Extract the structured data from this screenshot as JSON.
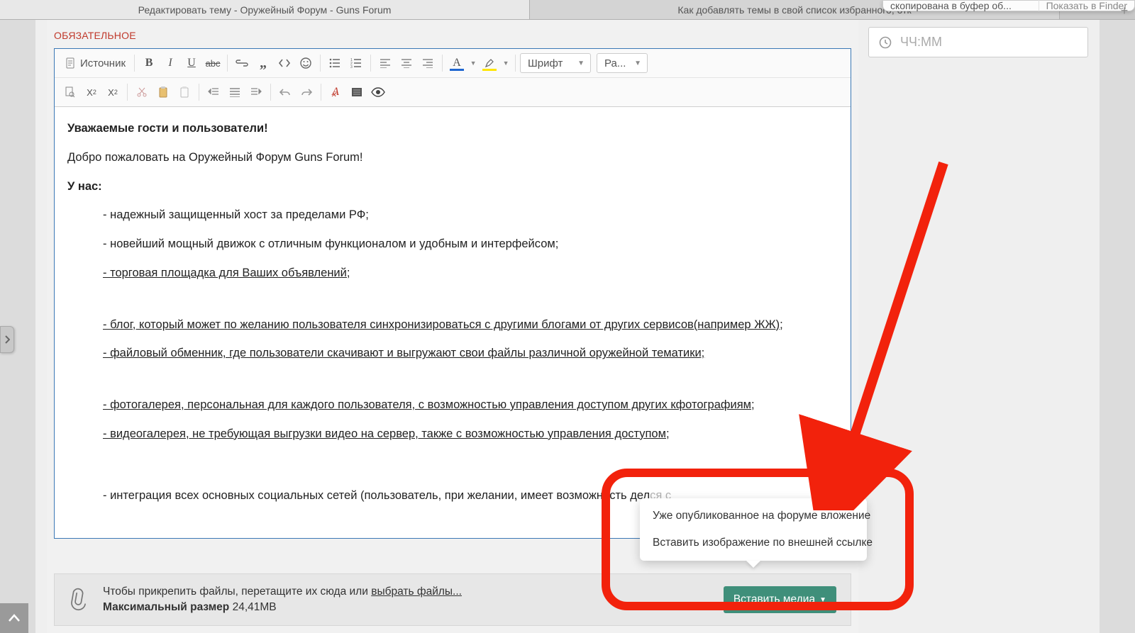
{
  "tabs": {
    "active": "Редактировать тему - Оружейный Форум - Guns Forum",
    "inactive": "Как добавлять темы в свой список избранного, отк"
  },
  "mac_toast": {
    "msg": "скопирована в буфер об...",
    "action": "Показать в Finder"
  },
  "required_label": "ОБЯЗАТЕЛЬНОЕ",
  "toolbar": {
    "source": "Источник",
    "font_combo": "Шрифт",
    "size_combo": "Ра..."
  },
  "content": {
    "greeting_bold": "Уважаемые гости и пользователи!",
    "welcome": "Добро пожаловать на Оружейный Форум Guns Forum!",
    "we_have": "У нас:",
    "l1": "- надежный защищенный хост за пределами РФ;",
    "l2": "- новейший мощный движок с отличным функционалом и удобным и интерфейсом;",
    "l3": "- торговая площадка для Ваших объявлений;",
    "l4": "- блог, который может по желанию пользователя синхронизироваться с другими блогами от других сервисов(например ЖЖ);",
    "l5": "- файловый обменник, где пользователи скачивают и выгружают свои файлы различной оружейной тематики;",
    "l6": "- фотогалерея, персональная для каждого пользователя, с возможностью управления доступом других кфотографиям;",
    "l7": "- видеогалерея, не требующая выгрузки видео на сервер, также с возможностью управления доступом;",
    "l8_a": "- интеграция всех основных социальных сетей (пользователь, при желании, имеет возможность дел",
    "l8_b": "ся с"
  },
  "upload": {
    "hint_a": "Чтобы прикрепить файлы, перетащите их сюда или ",
    "choose": "выбрать файлы...",
    "maxsize_label": "Максимальный размер",
    "maxsize_val": "24,41MB",
    "insert_media": "Вставить медиа"
  },
  "popup": {
    "opt1": "Уже опубликованное на форуме вложение",
    "opt2": "Вставить изображение по внешней ссылке"
  },
  "side": {
    "time_placeholder": "ЧЧ:ММ"
  }
}
